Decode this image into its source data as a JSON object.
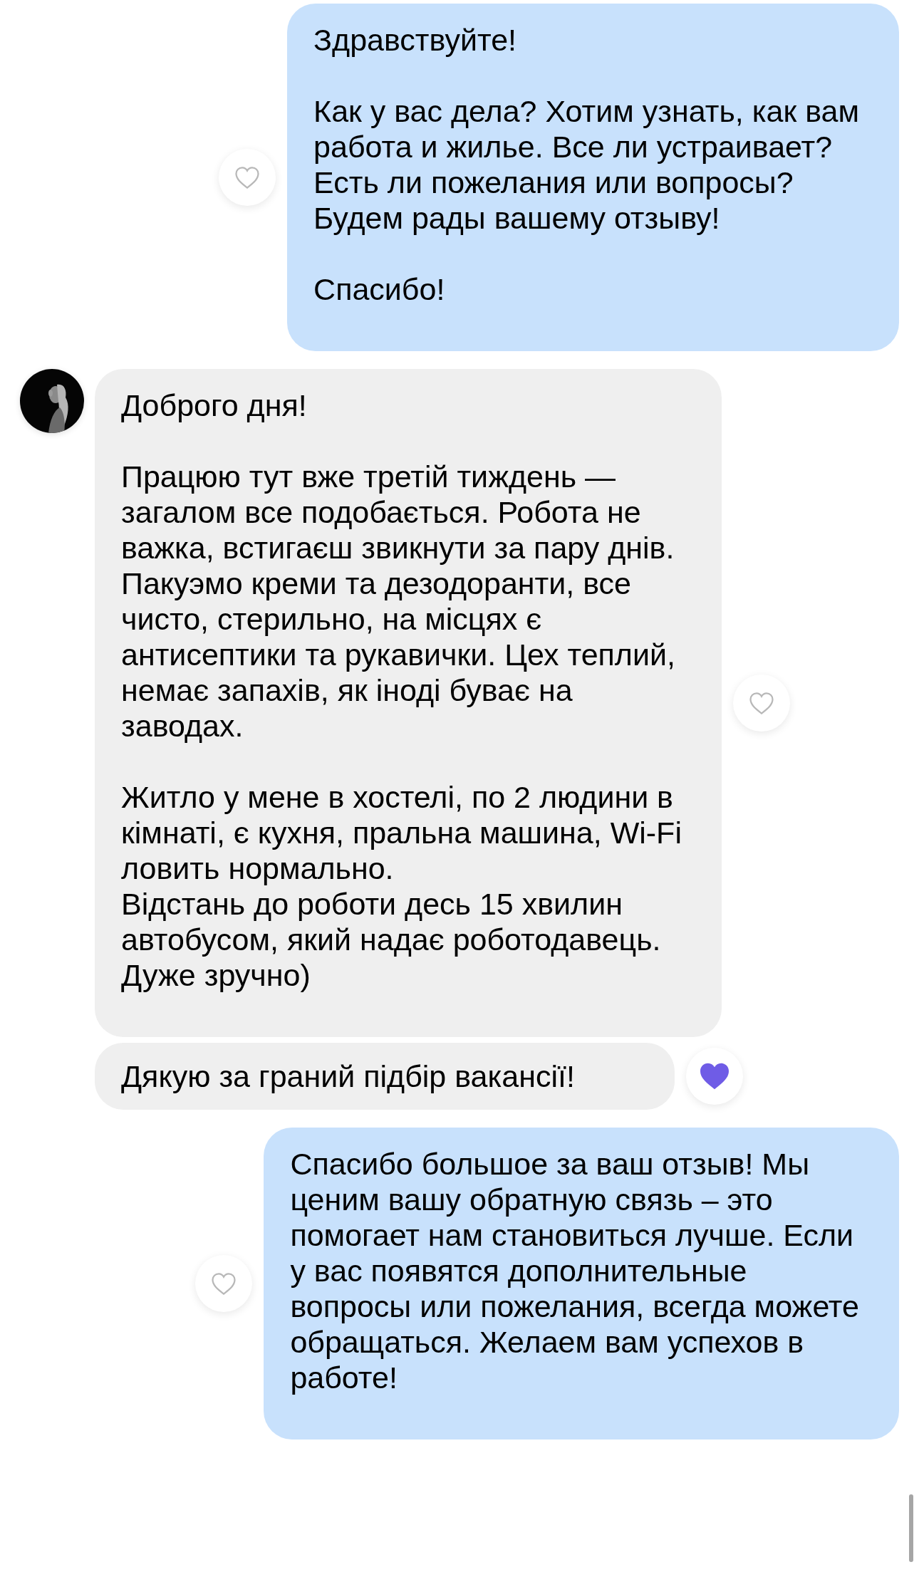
{
  "messages": [
    {
      "kind": "outgoing",
      "text": "Здравствуйте!\n\nКак у вас дела? Хотим узнать, как вам\nработа и жилье. Все ли устраивает?\nЕсть ли пожелания или вопросы?\nБудем рады вашему отзыву!\n\nСпасибо!",
      "liked": false
    },
    {
      "kind": "incoming",
      "text": "Доброго дня!\n\nПрацюю тут вже третій тиждень —\nзагалом все подобається. Робота не\nважка, встигаєш звикнути за пару днів.\nПакуэмо креми та дезодоранти, все\nчисто, стерильно, на місцях є\nантисептики та рукавички. Цех теплий,\nнемає запахів, як іноді буває на\nзаводах.\n\nЖитло у мене в хостелі, по 2 людини в\nкімнаті, є кухня, пральна машина, Wi-Fi\nловить нормально.\nВідстань до роботи десь 15 хвилин\nавтобусом, який надає роботодавець.\nДуже зручно)",
      "liked": false
    },
    {
      "kind": "incoming",
      "text": "Дякую за граний підбір вакансії!",
      "liked": true
    },
    {
      "kind": "outgoing",
      "text": "Спасибо большое за ваш отзыв! Мы\nценим вашу обратную связь – это\nпомогает нам становиться лучше. Если\nу вас появятся дополнительные\nвопросы или пожелания, всегда можете\nобращаться. Желаем вам успехов в\nработе!",
      "liked": false
    }
  ]
}
